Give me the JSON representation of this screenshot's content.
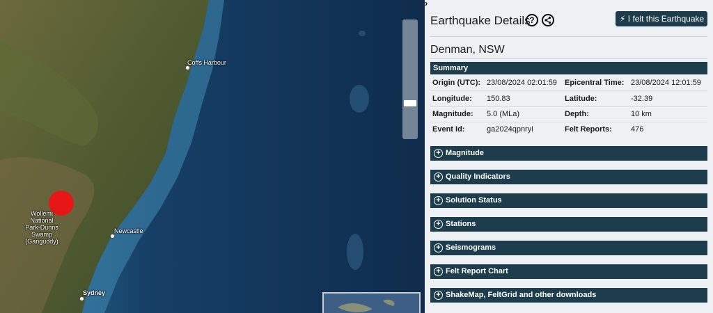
{
  "map": {
    "places": [
      {
        "name": "Coffs Harbour"
      },
      {
        "name": "Wollemi\nNational\nPark-Dunns\nSwamp\n(Ganguddy)"
      },
      {
        "name": "Newcastle"
      },
      {
        "name": "Sydney"
      }
    ]
  },
  "panel": {
    "title": "Earthquake Details",
    "felt_button": "I felt this Earthquake",
    "location": "Denman, NSW",
    "summary": {
      "heading": "Summary",
      "rows": [
        {
          "k1": "Origin (UTC):",
          "v1": "23/08/2024 02:01:59",
          "k2": "Epicentral Time:",
          "v2": "23/08/2024 12:01:59"
        },
        {
          "k1": "Longitude:",
          "v1": "150.83",
          "k2": "Latitude:",
          "v2": "-32.39"
        },
        {
          "k1": "Magnitude:",
          "v1": "5.0 (MLa)",
          "k2": "Depth:",
          "v2": "10 km"
        },
        {
          "k1": "Event Id:",
          "v1": "ga2024qpnryi",
          "k2": "Felt Reports:",
          "v2": "476"
        }
      ]
    },
    "sections": [
      {
        "label": "Magnitude"
      },
      {
        "label": "Quality Indicators"
      },
      {
        "label": "Solution Status"
      },
      {
        "label": "Stations"
      },
      {
        "label": "Seismograms"
      },
      {
        "label": "Felt Report Chart"
      },
      {
        "label": "ShakeMap, FeltGrid and other downloads"
      }
    ]
  }
}
